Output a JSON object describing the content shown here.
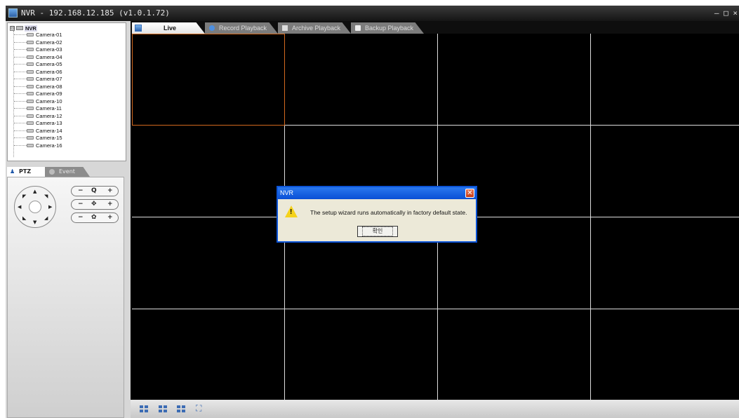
{
  "window": {
    "title": "NVR - 192.168.12.185 (v1.0.1.72)",
    "controls": "–  □  ×",
    "icon": "app-icon"
  },
  "tree": {
    "root_label": "NVR",
    "expander": "⊟",
    "cameras": [
      "Camera-01",
      "Camera-02",
      "Camera-03",
      "Camera-04",
      "Camera-05",
      "Camera-06",
      "Camera-07",
      "Camera-08",
      "Camera-09",
      "Camera-10",
      "Camera-11",
      "Camera-12",
      "Camera-13",
      "Camera-14",
      "Camera-15",
      "Camera-16"
    ]
  },
  "ptz_tabs": {
    "ptz": "PTZ",
    "event": "Event"
  },
  "ptz_controls": {
    "minus": "−",
    "plus": "+",
    "zoom_icon": "Q",
    "focus_icon": "✥",
    "iris_icon": "✿",
    "arrows": {
      "up": "▲",
      "down": "▼",
      "left": "◀",
      "right": "▶",
      "ul": "◤",
      "ur": "◥",
      "dl": "◣",
      "dr": "◢"
    }
  },
  "main_tabs": {
    "live": "Live",
    "record_playback": "Record Playback",
    "archive_playback": "Archive Playback",
    "backup_playback": "Backup Playback"
  },
  "layout_buttons": [
    "layout-1-icon",
    "layout-4-icon",
    "layout-9-icon",
    "fullscreen-icon"
  ],
  "fullscreen_glyph": "⛶",
  "dialog": {
    "title": "NVR",
    "close": "✕",
    "message": "The setup wizard runs automatically in factory default state.",
    "ok_label": "확인",
    "warning_mark": "!"
  },
  "colors": {
    "selected_cell_border": "#d2691e",
    "dialog_title": "#0a4fd5",
    "grid_line": "#dcdcdc"
  }
}
